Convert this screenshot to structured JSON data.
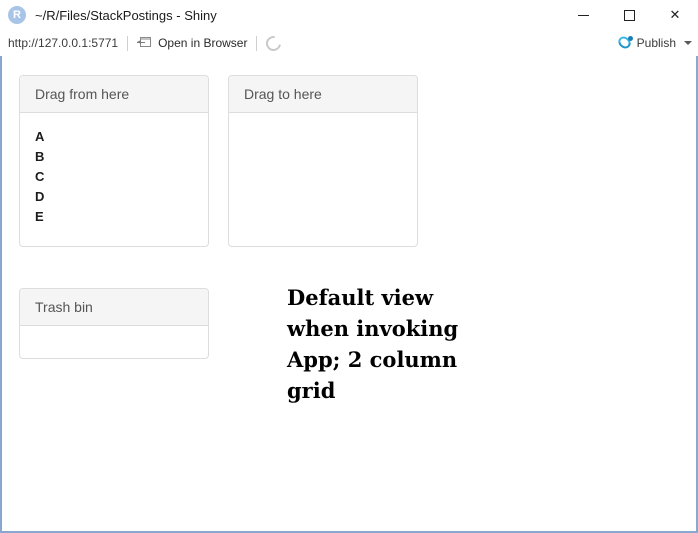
{
  "window": {
    "title": "~/R/Files/StackPostings - Shiny",
    "app_icon": "r-logo-icon",
    "controls": {
      "minimize": "minimize-icon",
      "maximize": "maximize-icon",
      "close": "✕"
    }
  },
  "toolbar": {
    "url": "http://127.0.0.1:5771",
    "open_in_browser_label": "Open in Browser",
    "open_in_browser_icon": "open-in-browser-icon",
    "refresh_icon": "refresh-icon",
    "publish_label": "Publish",
    "publish_icon": "publish-icon",
    "publish_caret": "chevron-down-icon"
  },
  "panels": {
    "drag_from": {
      "title": "Drag from here",
      "items": [
        "A",
        "B",
        "C",
        "D",
        "E"
      ]
    },
    "drag_to": {
      "title": "Drag to here",
      "items": []
    },
    "trash": {
      "title": "Trash bin",
      "items": []
    }
  },
  "annotation": {
    "text": "Default view when invoking App; 2 column grid"
  },
  "colors": {
    "accent_blue": "#2196c9",
    "panel_header_bg": "#f5f5f5",
    "panel_border": "#dddddd",
    "viewport_border": "#8aa7d0"
  }
}
